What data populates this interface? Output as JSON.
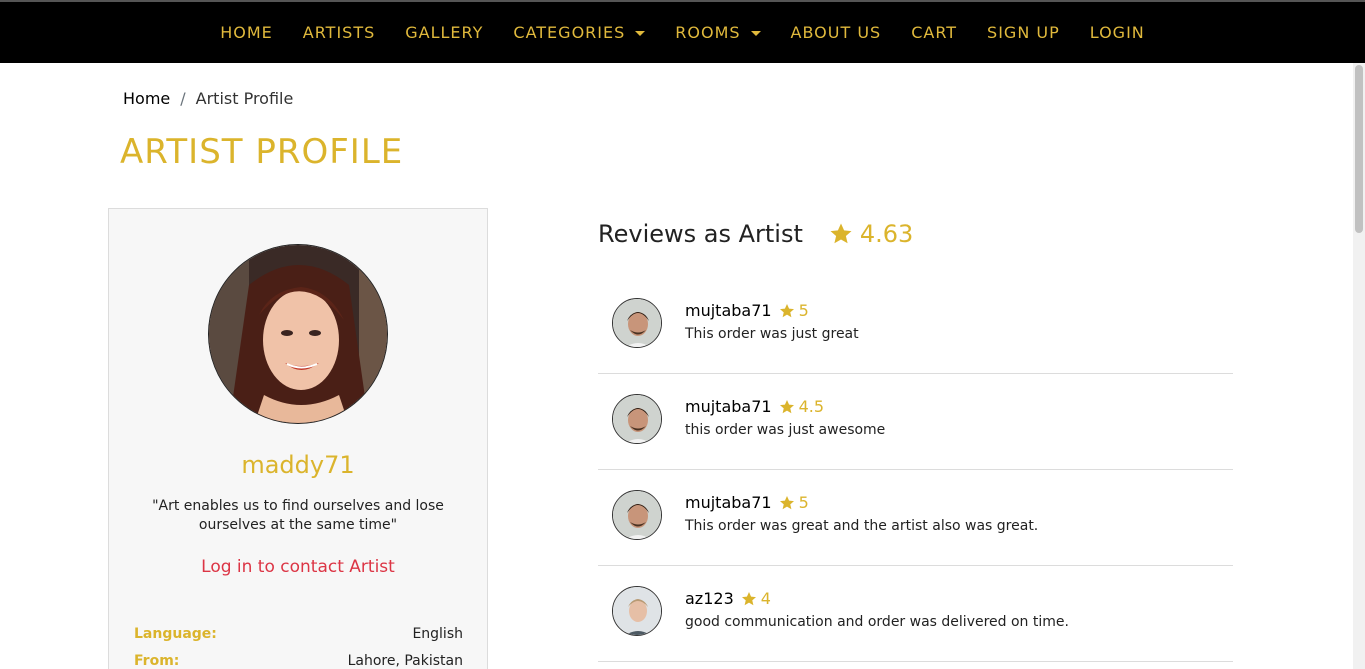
{
  "nav": {
    "items": [
      {
        "label": "HOME",
        "dropdown": false
      },
      {
        "label": "ARTISTS",
        "dropdown": false
      },
      {
        "label": "GALLERY",
        "dropdown": false
      },
      {
        "label": "CATEGORIES",
        "dropdown": true
      },
      {
        "label": "ROOMS",
        "dropdown": true
      },
      {
        "label": "ABOUT US",
        "dropdown": false
      },
      {
        "label": "CART",
        "dropdown": false
      },
      {
        "label": "SIGN UP",
        "dropdown": false
      },
      {
        "label": "LOGIN",
        "dropdown": false
      }
    ]
  },
  "breadcrumb": {
    "home": "Home",
    "separator": "/",
    "current": "Artist Profile"
  },
  "page_title": "ARTIST PROFILE",
  "profile": {
    "username": "maddy71",
    "quote": "\"Art enables us to find ourselves and lose ourselves at the same time\"",
    "contact_link": "Log in to contact Artist",
    "info": [
      {
        "label": "Language:",
        "value": "English"
      },
      {
        "label": "From:",
        "value": "Lahore, Pakistan"
      }
    ]
  },
  "reviews": {
    "title": "Reviews as Artist",
    "rating": "4.63",
    "items": [
      {
        "name": "mujtaba71",
        "score": "5",
        "text": "This order was just great",
        "avatar": "man-dark-hair"
      },
      {
        "name": "mujtaba71",
        "score": "4.5",
        "text": "this order was just awesome",
        "avatar": "man-dark-hair"
      },
      {
        "name": "mujtaba71",
        "score": "5",
        "text": "This order was great and the artist also was great.",
        "avatar": "man-dark-hair"
      },
      {
        "name": "az123",
        "score": "4",
        "text": "good communication and order was delivered on time.",
        "avatar": "man-light-hair"
      }
    ]
  },
  "colors": {
    "accent": "#dbb42c",
    "nav_bg": "#000000",
    "link_red": "#dc3545"
  }
}
